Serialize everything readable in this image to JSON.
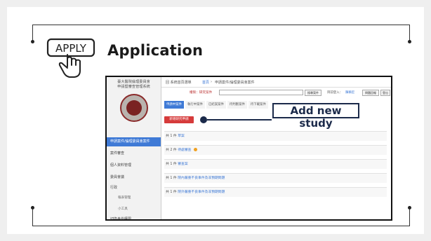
{
  "heading": "Application",
  "apply_icon": {
    "icon": "hand-pointer-apply-icon",
    "text": "APPLY"
  },
  "callout": "Add new study",
  "screenshot": {
    "sidebar_title_lines": [
      "臺大醫院倫理委員會",
      "申請暨審查管理系統"
    ],
    "seal_icon": "university-seal-icon",
    "sidebar_items": [
      {
        "label": "申請案件/倫理委員會案件",
        "active": true
      },
      {
        "label": "案件審查",
        "active": false
      },
      {
        "label": "個人資料管理",
        "active": false
      },
      {
        "label": "委員會議",
        "active": false
      },
      {
        "label": "行政",
        "active": false
      }
    ],
    "sidebar_subitems": [
      "報表管理",
      "小工具"
    ],
    "sidebar_bottom": "切換身份權限",
    "topbar": {
      "back": "回 系統首頁選單",
      "breadcrumb_home": "首頁",
      "breadcrumb_current": "申請案件/倫理委員會案件",
      "search_label": "權限：研究案件",
      "search_button": "搜尋案件",
      "login_label": "目前登入：",
      "login_user": "陳賴宏",
      "help_button": "問題回報",
      "logout_button": "登出"
    },
    "tabs": [
      "申請中案件",
      "執行中案件",
      "已結案案件",
      "待判斷案件",
      "待下載案件"
    ],
    "add_button": "新增研究申請",
    "rows": [
      {
        "prefix": "共 1 件",
        "link": "草案",
        "warn": false
      },
      {
        "prefix": "共 2 件",
        "link": "待處審查",
        "warn": true
      },
      {
        "prefix": "共 1 件",
        "link": "審查案",
        "warn": false
      },
      {
        "prefix": "共 1 件",
        "link": "院內嚴重不良事件及非預期問題",
        "warn": false
      },
      {
        "prefix": "共 1 件",
        "link": "院外嚴重不良事件及非預期問題",
        "warn": false
      }
    ]
  }
}
